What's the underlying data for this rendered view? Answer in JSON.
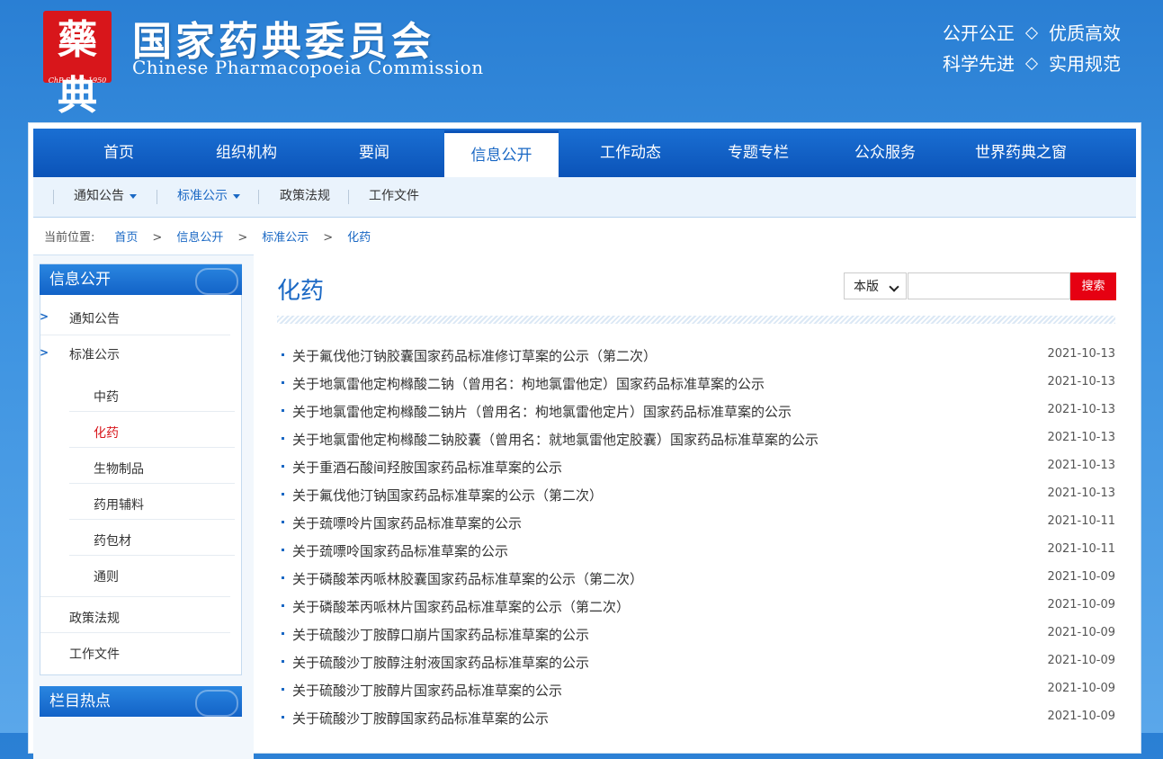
{
  "header": {
    "logo_glyph": "藥典",
    "logo_since": "ChP Since 1950",
    "title": "国家药典委员会",
    "subtitle": "Chinese Pharmacopoeia Commission",
    "slogans": [
      [
        "公开公正",
        "优质高效"
      ],
      [
        "科学先进",
        "实用规范"
      ]
    ]
  },
  "mainnav": [
    "首页",
    "组织机构",
    "要闻",
    "信息公开",
    "工作动态",
    "专题专栏",
    "公众服务",
    "世界药典之窗"
  ],
  "mainnav_active": 3,
  "subnav": [
    "通知公告",
    "标准公示",
    "政策法规",
    "工作文件"
  ],
  "breadcrumb": {
    "label": "当前位置:",
    "items": [
      "首页",
      "信息公开",
      "标准公示",
      "化药"
    ],
    "sep": ">"
  },
  "sidebar": {
    "head": "信息公开",
    "menu": [
      "通知公告",
      "标准公示"
    ],
    "submenu": [
      "中药",
      "化药",
      "生物制品",
      "药用辅料",
      "药包材",
      "通则"
    ],
    "submenu_active": 1,
    "menu2": [
      "政策法规",
      "工作文件"
    ],
    "head2": "栏目热点"
  },
  "content": {
    "title": "化药",
    "search_scope": "本版",
    "search_button": "搜索",
    "news": [
      {
        "title": "关于氟伐他汀钠胶囊国家药品标准修订草案的公示（第二次）",
        "date": "2021-10-13"
      },
      {
        "title": "关于地氯雷他定枸橼酸二钠（曾用名：枸地氯雷他定）国家药品标准草案的公示",
        "date": "2021-10-13"
      },
      {
        "title": "关于地氯雷他定枸橼酸二钠片（曾用名：枸地氯雷他定片）国家药品标准草案的公示",
        "date": "2021-10-13"
      },
      {
        "title": "关于地氯雷他定枸橼酸二钠胶囊（曾用名：就地氯雷他定胶囊）国家药品标准草案的公示",
        "date": "2021-10-13"
      },
      {
        "title": "关于重酒石酸间羟胺国家药品标准草案的公示",
        "date": "2021-10-13"
      },
      {
        "title": "关于氟伐他汀钠国家药品标准草案的公示（第二次）",
        "date": "2021-10-13"
      },
      {
        "title": "关于巯嘌呤片国家药品标准草案的公示",
        "date": "2021-10-11"
      },
      {
        "title": "关于巯嘌呤国家药品标准草案的公示",
        "date": "2021-10-11"
      },
      {
        "title": "关于磷酸苯丙哌林胶囊国家药品标准草案的公示（第二次）",
        "date": "2021-10-09"
      },
      {
        "title": "关于磷酸苯丙哌林片国家药品标准草案的公示（第二次）",
        "date": "2021-10-09"
      },
      {
        "title": "关于硫酸沙丁胺醇口崩片国家药品标准草案的公示",
        "date": "2021-10-09"
      },
      {
        "title": "关于硫酸沙丁胺醇注射液国家药品标准草案的公示",
        "date": "2021-10-09"
      },
      {
        "title": "关于硫酸沙丁胺醇片国家药品标准草案的公示",
        "date": "2021-10-09"
      },
      {
        "title": "关于硫酸沙丁胺醇国家药品标准草案的公示",
        "date": "2021-10-09"
      }
    ]
  }
}
